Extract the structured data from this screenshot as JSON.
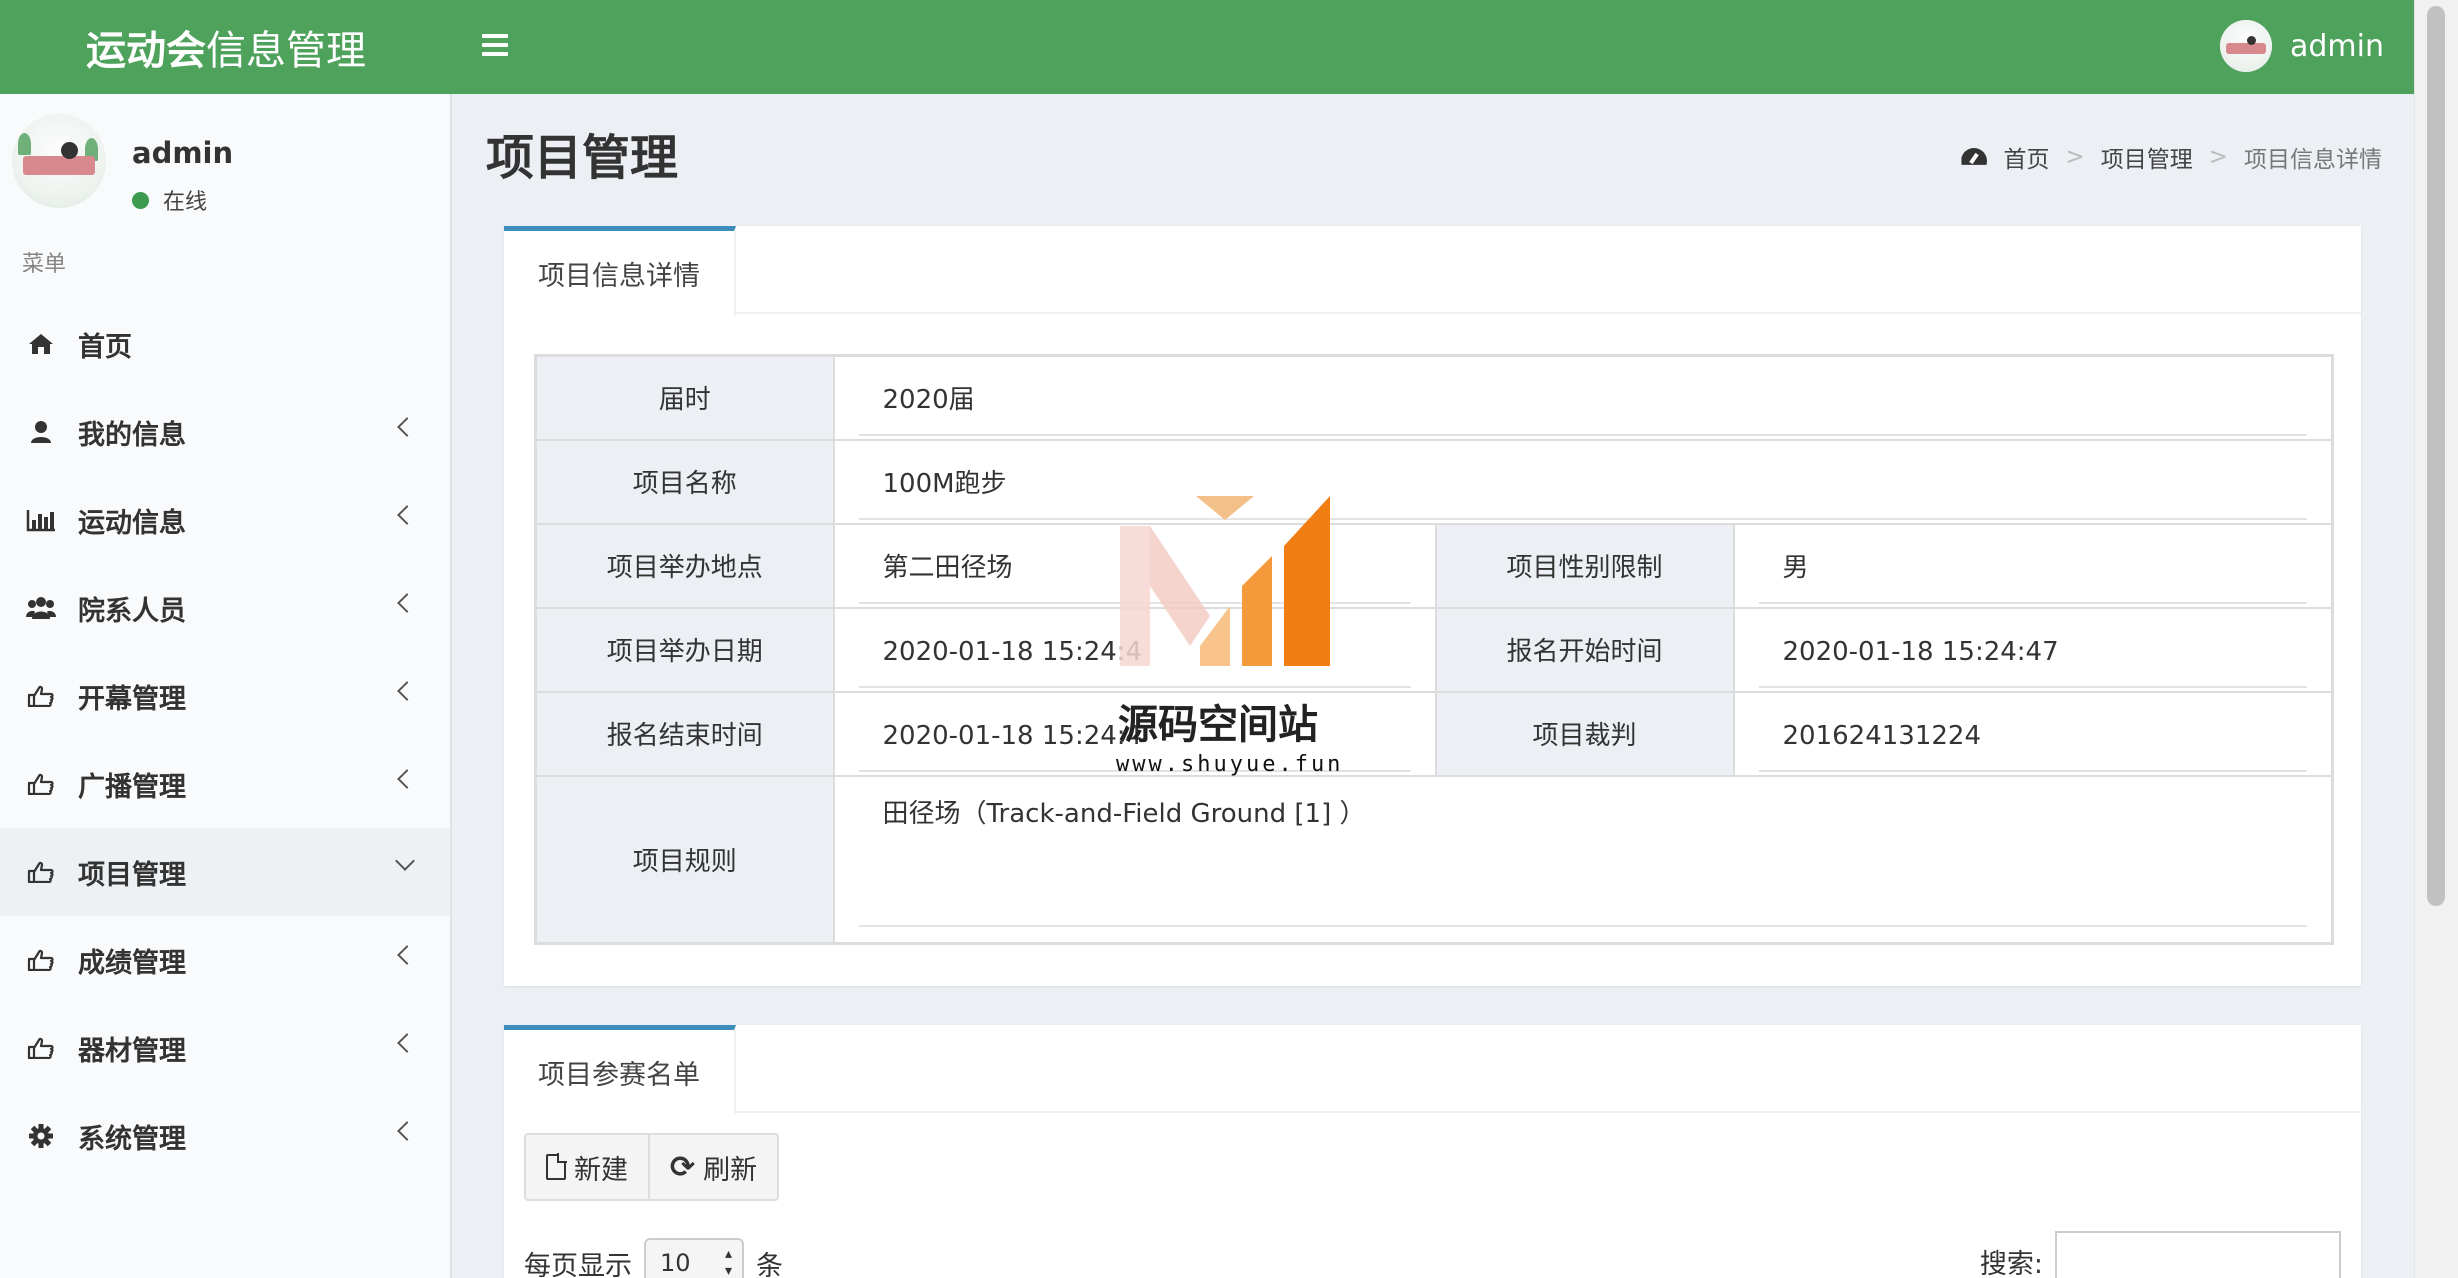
{
  "header": {
    "brand_bold": "运动会",
    "brand_rest": "信息管理",
    "user": "admin"
  },
  "sidebar": {
    "username": "admin",
    "status": "在线",
    "menu_header": "菜单",
    "items": [
      {
        "label": "首页",
        "icon": "home-icon"
      },
      {
        "label": "我的信息",
        "icon": "user-icon"
      },
      {
        "label": "运动信息",
        "icon": "bar-chart-icon"
      },
      {
        "label": "院系人员",
        "icon": "users-icon"
      },
      {
        "label": "开幕管理",
        "icon": "hand-point-icon"
      },
      {
        "label": "广播管理",
        "icon": "hand-point-icon"
      },
      {
        "label": "项目管理",
        "icon": "hand-point-icon"
      },
      {
        "label": "成绩管理",
        "icon": "hand-point-icon"
      },
      {
        "label": "器材管理",
        "icon": "hand-point-icon"
      },
      {
        "label": "系统管理",
        "icon": "gear-icon"
      }
    ]
  },
  "page": {
    "title": "项目管理",
    "breadcrumb": [
      "首页",
      "项目管理",
      "项目信息详情"
    ]
  },
  "detail": {
    "tab": "项目信息详情",
    "fields": {
      "session_label": "届时",
      "session": "2020届",
      "name_label": "项目名称",
      "name": "100M跑步",
      "venue_label": "项目举办地点",
      "venue": "第二田径场",
      "gender_label": "项目性别限制",
      "gender": "男",
      "date_label": "项目举办日期",
      "date": "2020-01-18 15:24:4",
      "reg_start_label": "报名开始时间",
      "reg_start": "2020-01-18 15:24:47",
      "reg_end_label": "报名结束时间",
      "reg_end": "2020-01-18 15:24:4",
      "judge_label": "项目裁判",
      "judge": "201624131224",
      "rules_label": "项目规则",
      "rules": "田径场（Track-and-Field Ground [1] ）"
    }
  },
  "participants": {
    "tab": "项目参赛名单",
    "new_label": "新建",
    "refresh_label": "刷新",
    "per_page_prefix": "每页显示",
    "per_page_value": "10",
    "per_page_suffix": "条",
    "search_label": "搜索:"
  },
  "watermark": {
    "title": "源码空间站",
    "url": "www.shuyue.fun"
  },
  "colors": {
    "header": "#4ea25c",
    "tab_accent": "#3c8dbc",
    "status_dot": "#3c9b4e"
  }
}
